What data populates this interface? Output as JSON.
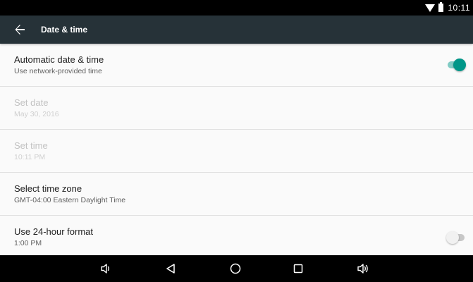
{
  "status_bar": {
    "time": "10:11",
    "icons": [
      "wifi-icon",
      "battery-icon"
    ]
  },
  "app_bar": {
    "title": "Date & time",
    "back_icon": "arrow-back-icon"
  },
  "settings": [
    {
      "id": "automatic-date-time",
      "title": "Automatic date & time",
      "subtitle": "Use network-provided time",
      "enabled": true,
      "toggle": true
    },
    {
      "id": "set-date",
      "title": "Set date",
      "subtitle": "May 30, 2016",
      "enabled": false
    },
    {
      "id": "set-time",
      "title": "Set time",
      "subtitle": "10:11 PM",
      "enabled": false
    },
    {
      "id": "select-time-zone",
      "title": "Select time zone",
      "subtitle": "GMT-04:00 Eastern Daylight Time",
      "enabled": true
    },
    {
      "id": "use-24-hour-format",
      "title": "Use 24-hour format",
      "subtitle": "1:00 PM",
      "enabled": true,
      "toggle": false
    }
  ],
  "nav_bar": {
    "icons": [
      "volume-down-icon",
      "back-triangle-icon",
      "home-circle-icon",
      "recents-square-icon",
      "volume-up-icon"
    ]
  },
  "colors": {
    "app_bar": "#263238",
    "accent": "#009688",
    "accent_track": "#80cbc4",
    "status_bar": "#000000",
    "background": "#fafafa"
  }
}
